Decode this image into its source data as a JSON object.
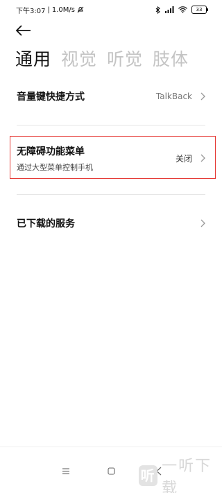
{
  "status_bar": {
    "time": "下午3:07",
    "speed": "1.0M/s",
    "battery": "33"
  },
  "tabs": [
    {
      "label": "通用",
      "active": true
    },
    {
      "label": "视觉",
      "active": false
    },
    {
      "label": "听觉",
      "active": false
    },
    {
      "label": "肢体",
      "active": false
    }
  ],
  "rows": {
    "volume_shortcut": {
      "title": "音量键快捷方式",
      "value": "TalkBack"
    },
    "accessibility_menu": {
      "title": "无障碍功能菜单",
      "subtitle": "通过大型菜单控制手机",
      "value": "关闭"
    },
    "downloaded_services": {
      "title": "已下载的服务"
    }
  },
  "watermark": {
    "logo_char": "听",
    "text": "一听下载"
  },
  "colors": {
    "highlight": "#e53935",
    "inactive_tab": "#c4c4c4"
  }
}
